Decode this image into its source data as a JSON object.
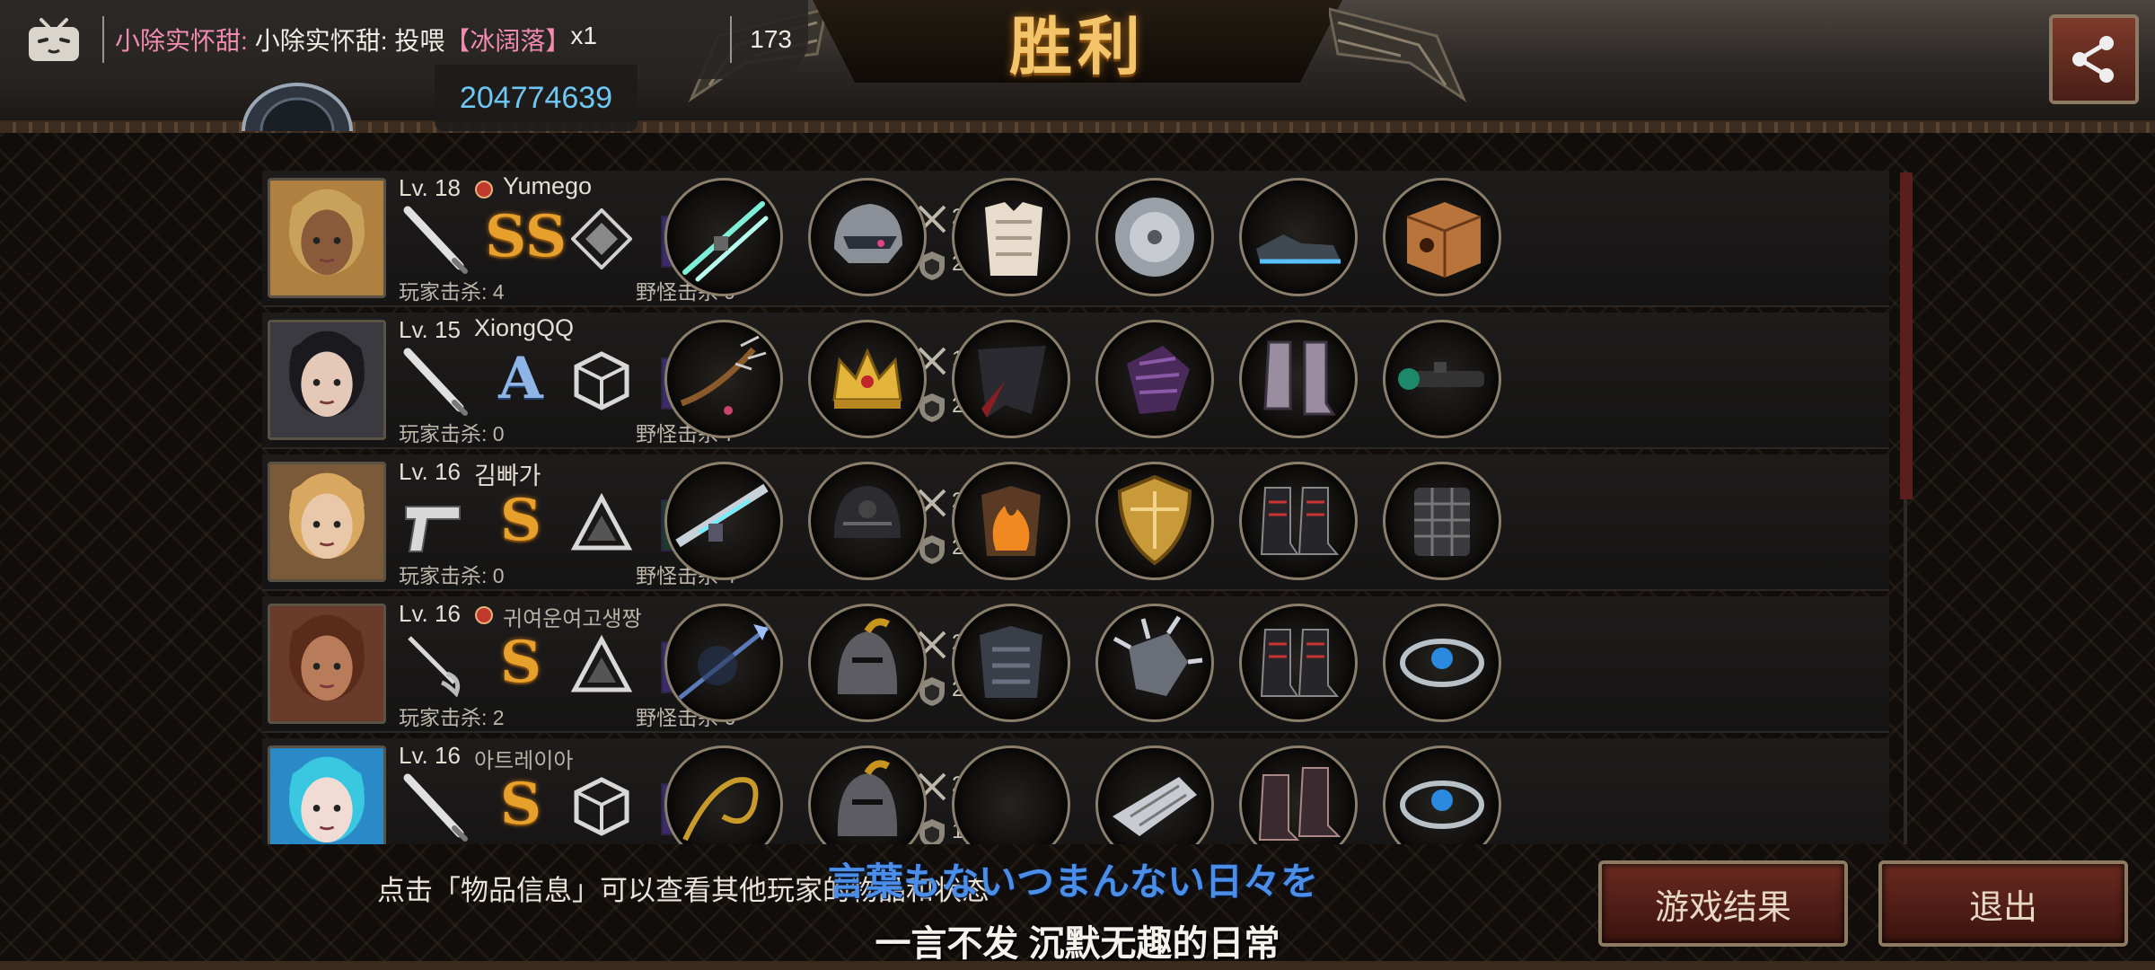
{
  "title": "胜利",
  "colors": {
    "title_gold": "#f4c46a",
    "danmaku_user": "#f28bb0",
    "room_id": "#6fc8f4",
    "button_red": "#6a2a20"
  },
  "live_overlay": {
    "danmaku_user": "小除实怀甜:",
    "danmaku_text": "小除实怀甜: 投喂",
    "danmaku_gift": "【冰阔落】",
    "danmaku_count": "x1",
    "viewer_count": "173",
    "room_id": "204774639"
  },
  "players": [
    {
      "level": "Lv. 18",
      "name": "Yumego",
      "has_guild_icon": true,
      "grade": "SS",
      "rank_icon": "diamond-rank-icon",
      "weapon_icon": "bat-icon",
      "player_kills": "玩家击杀: 4",
      "monster_kills": "野怪击杀 9",
      "attack": "236",
      "defense": "251",
      "items": [
        "lightsaber-icon",
        "visor-helmet-icon",
        "white-armor-icon",
        "disc-icon",
        "sneakers-icon",
        "cat-box-icon"
      ]
    },
    {
      "level": "Lv. 15",
      "name": "XiongQQ",
      "has_guild_icon": false,
      "grade": "A",
      "rank_icon": "cube-rank-icon",
      "weapon_icon": "bat-icon",
      "player_kills": "玩家击杀: 0",
      "monster_kills": "野怪击杀 7",
      "attack": "187",
      "defense": "232",
      "items": [
        "spiked-whip-icon",
        "crown-icon",
        "dark-cloak-icon",
        "purple-gauntlet-icon",
        "boots-icon",
        "scope-icon"
      ]
    },
    {
      "level": "Lv. 16",
      "name": "김빠가",
      "has_guild_icon": false,
      "grade": "S",
      "rank_icon": "triangle-rank-icon",
      "weapon_icon": "pistol-icon",
      "player_kills": "玩家击杀: 0",
      "monster_kills": "野怪击杀 4",
      "attack": "226",
      "defense": "262",
      "items": [
        "laser-rifle-icon",
        "black-helmet-icon",
        "flame-armor-icon",
        "gold-shield-icon",
        "combat-boots-icon",
        "grid-armor-icon"
      ]
    },
    {
      "level": "Lv. 16",
      "name": "귀여운여고생짱",
      "has_guild_icon": true,
      "grade": "S",
      "rank_icon": "triangle-rank-icon",
      "weapon_icon": "rapier-icon",
      "player_kills": "玩家击杀: 2",
      "monster_kills": "野怪击杀 6",
      "attack": "217",
      "defense": "289",
      "items": [
        "blue-spear-icon",
        "knight-helmet-icon",
        "dark-plate-icon",
        "spiked-gauntlet-icon",
        "combat-boots-icon",
        "blue-bracelet-icon"
      ]
    },
    {
      "level": "Lv. 16",
      "name": "아트레이아",
      "has_guild_icon": false,
      "grade": "S",
      "rank_icon": "cube-rank-icon",
      "weapon_icon": "bat-icon",
      "player_kills": "",
      "monster_kills": "",
      "attack": "228",
      "defense": "172",
      "items": [
        "gold-whip-icon",
        "knight-helmet-icon",
        "empty-slot",
        "silver-gauntlet-icon",
        "dark-boots-icon",
        "blue-bracelet-icon"
      ]
    }
  ],
  "hint": "点击「物品信息」可以查看其他玩家的物品和状态",
  "subtitles": {
    "japanese": "言葉もないつまんない日々を",
    "chinese": "一言不发 沉默无趣的日常"
  },
  "buttons": {
    "result": "游戏结果",
    "exit": "退出"
  }
}
